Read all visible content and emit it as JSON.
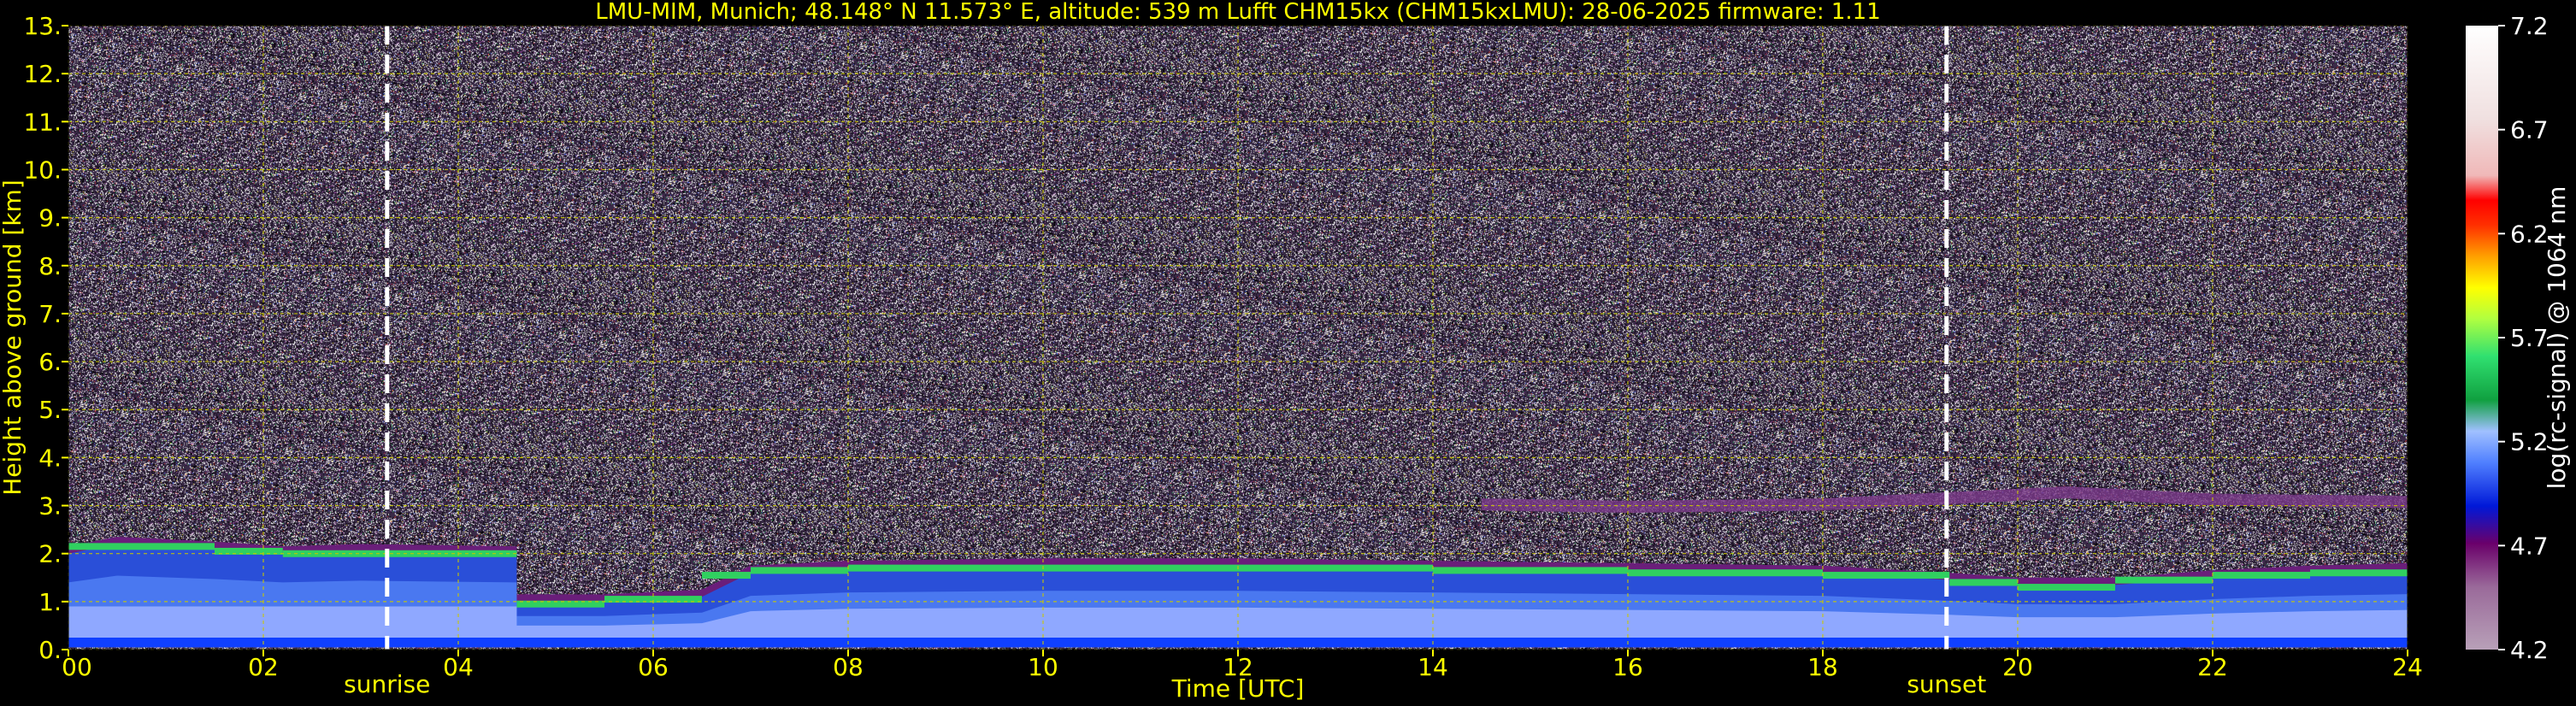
{
  "chart_data": {
    "type": "heatmap",
    "title": "LMU-MIM, Munich; 48.148° N 11.573° E, altitude: 539 m    Lufft CHM15kx (CHM15kxLMU): 28-06-2025    firmware: 1.11",
    "xlabel": "Time [UTC]",
    "ylabel": "Height above ground [km]",
    "xlim": [
      0,
      24
    ],
    "ylim": [
      0,
      13
    ],
    "x_ticks": [
      "00",
      "02",
      "04",
      "06",
      "08",
      "10",
      "12",
      "14",
      "16",
      "18",
      "20",
      "22",
      "24"
    ],
    "y_ticks": [
      "0.",
      "1.",
      "2.",
      "3.",
      "4.",
      "5.",
      "6.",
      "7.",
      "8.",
      "9.",
      "10.",
      "11.",
      "12.",
      "13."
    ],
    "grid": true,
    "colorbar": {
      "label": "log(rc-signal) @ 1064 nm",
      "range": [
        4.2,
        7.2
      ],
      "ticks": [
        "4.2",
        "4.7",
        "5.2",
        "5.7",
        "6.2",
        "6.7",
        "7.2"
      ]
    },
    "annotations": [
      {
        "label": "sunrise",
        "x": 3.27
      },
      {
        "label": "sunset",
        "x": 19.27
      }
    ],
    "boundary_layer_top_km": [
      [
        0.0,
        2.0
      ],
      [
        0.5,
        2.2
      ],
      [
        1.5,
        2.1
      ],
      [
        2.2,
        2.0
      ],
      [
        3.0,
        2.05
      ],
      [
        4.6,
        2.0
      ],
      [
        4.6,
        1.0
      ],
      [
        5.5,
        1.0
      ],
      [
        6.5,
        1.1
      ],
      [
        7.0,
        1.6
      ],
      [
        8.0,
        1.7
      ],
      [
        10.0,
        1.75
      ],
      [
        12.0,
        1.75
      ],
      [
        14.0,
        1.7
      ],
      [
        16.0,
        1.65
      ],
      [
        18.0,
        1.6
      ],
      [
        19.3,
        1.45
      ],
      [
        20.0,
        1.35
      ],
      [
        21.0,
        1.35
      ],
      [
        22.0,
        1.5
      ],
      [
        23.0,
        1.6
      ],
      [
        24.0,
        1.65
      ]
    ],
    "elevated_layer_km": [
      [
        14.5,
        3.05
      ],
      [
        16.0,
        3.0
      ],
      [
        18.0,
        3.05
      ],
      [
        19.5,
        3.2
      ],
      [
        20.5,
        3.3
      ],
      [
        22.0,
        3.15
      ],
      [
        24.0,
        3.1
      ]
    ]
  },
  "colors": {
    "text": "#ffff00",
    "grid": "#c8c800",
    "background_noise": "#3a2a48",
    "marker": "#ffffff"
  }
}
